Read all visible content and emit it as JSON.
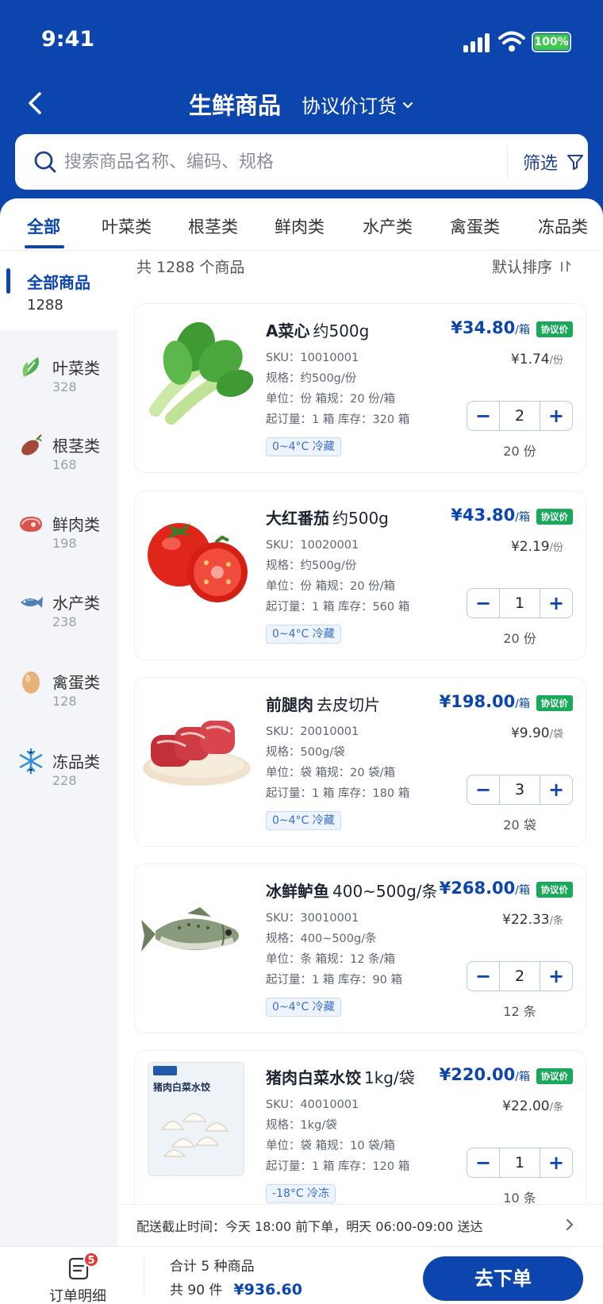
{
  "status_bar": {
    "time": "9:41",
    "battery": "100%"
  },
  "nav": {
    "title": "生鲜商品",
    "mode": "协议价订货"
  },
  "search": {
    "placeholder": "搜索商品名称、编码、规格",
    "filter_label": "筛选"
  },
  "tabs": [
    "全部",
    "叶菜类",
    "根茎类",
    "鲜肉类",
    "水产类",
    "禽蛋类",
    "冻品类"
  ],
  "sidebar": [
    {
      "label": "全部商品",
      "count": "1288",
      "icon": "none"
    },
    {
      "label": "叶菜类",
      "count": "328",
      "icon": "leafy-vegetable-icon"
    },
    {
      "label": "根茎类",
      "count": "168",
      "icon": "sweet-potato-icon"
    },
    {
      "label": "鲜肉类",
      "count": "198",
      "icon": "meat-icon"
    },
    {
      "label": "水产类",
      "count": "238",
      "icon": "fish-icon"
    },
    {
      "label": "禽蛋类",
      "count": "128",
      "icon": "egg-icon"
    },
    {
      "label": "冻品类",
      "count": "228",
      "icon": "snowflake-icon"
    }
  ],
  "list": {
    "summary": "共 1288 个商品",
    "sort_label": "默认排序"
  },
  "products": [
    {
      "name": "A菜心",
      "spec": "约500g",
      "sku": "SKU：10010001",
      "guige": "规格：约500g/份",
      "unit_line": "单位：份    箱规：20 份/箱",
      "moq_line": "起订量：1 箱    库存：320 箱",
      "temp": "0~4°C 冷藏",
      "price": "¥34.80",
      "price_unit": "/箱",
      "tag": "协议价",
      "unit_price": "¥1.74",
      "unit_price_unit": "/份",
      "qty": "2",
      "total": "20 份",
      "image": "bok-choy"
    },
    {
      "name": "大红番茄",
      "spec": "约500g",
      "sku": "SKU：10020001",
      "guige": "规格：约500g/份",
      "unit_line": "单位：份    箱规：20 份/箱",
      "moq_line": "起订量：1 箱    库存：560 箱",
      "temp": "0~4°C 冷藏",
      "price": "¥43.80",
      "price_unit": "/箱",
      "tag": "协议价",
      "unit_price": "¥2.19",
      "unit_price_unit": "/份",
      "qty": "1",
      "total": "20 份",
      "image": "tomato"
    },
    {
      "name": "前腿肉",
      "spec": "去皮切片",
      "sku": "SKU：20010001",
      "guige": "规格：500g/袋",
      "unit_line": "单位：袋    箱规：20 袋/箱",
      "moq_line": "起订量：1 箱    库存：180 箱",
      "temp": "0~4°C 冷藏",
      "price": "¥198.00",
      "price_unit": "/箱",
      "tag": "协议价",
      "unit_price": "¥9.90",
      "unit_price_unit": "/袋",
      "qty": "3",
      "total": "20 袋",
      "image": "pork"
    },
    {
      "name": "冰鲜鲈鱼",
      "spec": "400~500g/条",
      "sku": "SKU：30010001",
      "guige": "规格：400~500g/条",
      "unit_line": "单位：条    箱规：12 条/箱",
      "moq_line": "起订量：1 箱    库存：90 箱",
      "temp": "0~4°C 冷藏",
      "price": "¥268.00",
      "price_unit": "/箱",
      "tag": "协议价",
      "unit_price": "¥22.33",
      "unit_price_unit": "/条",
      "qty": "2",
      "total": "12 条",
      "image": "fish"
    },
    {
      "name": "猪肉白菜水饺",
      "spec": "1kg/袋",
      "sku": "SKU：40010001",
      "guige": "规格：1kg/袋",
      "unit_line": "单位：袋    箱规：10 袋/箱",
      "moq_line": "起订量：1 箱    库存：120 箱",
      "temp": "-18°C 冷冻",
      "price": "¥220.00",
      "price_unit": "/箱",
      "tag": "协议价",
      "unit_price": "¥22.00",
      "unit_price_unit": "/条",
      "qty": "1",
      "total": "10 条",
      "image": "dumplings",
      "package_text": "猪肉白菜水饺"
    }
  ],
  "delivery": {
    "text": "配送截止时间：今天 18:00 前下单，明天 06:00-09:00 送达"
  },
  "bottom": {
    "order_detail": "订单明细",
    "badge": "5",
    "summary1": "合计  5 种商品",
    "summary2": "共 90 件",
    "total": "¥936.60",
    "submit": "去下单"
  },
  "colors": {
    "brand": "#0b45ad",
    "tag_green": "#1aa85a",
    "badge_red": "#e53935"
  }
}
